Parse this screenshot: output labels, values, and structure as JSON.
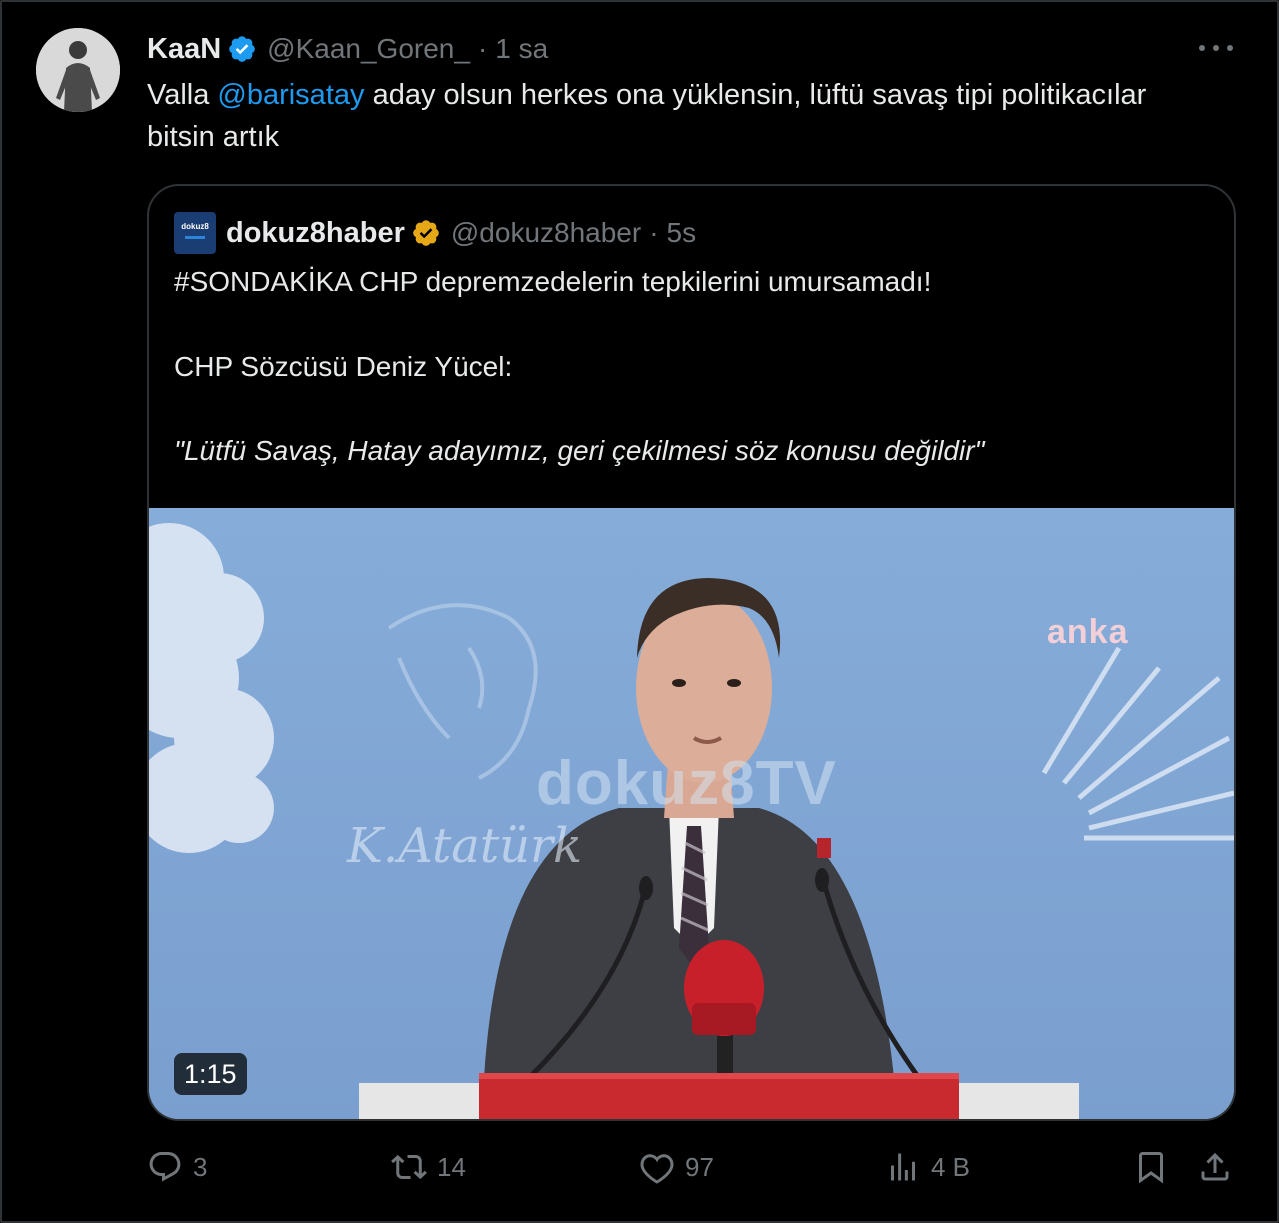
{
  "tweet": {
    "author": {
      "display_name": "KaaN",
      "handle": "@Kaan_Goren_",
      "verified": true,
      "avatar_icon": "person-photo"
    },
    "separator": "·",
    "time": "1 sa",
    "text_before": "Valla ",
    "mention": "@barisatay",
    "text_after": " aday olsun herkes ona yüklensin, lüftü savaş tipi politikacılar bitsin artık"
  },
  "quote": {
    "author": {
      "display_name": "dokuz8haber",
      "handle": "@dokuz8haber",
      "verified": true,
      "verified_color": "#e6a817",
      "avatar_text": "dokuz8",
      "avatar_text_small": "HABER"
    },
    "separator": "·",
    "time": "5s",
    "line1": "#SONDAKİKA CHP depremzedelerin tepkilerini umursamadı!",
    "line2": "CHP Sözcüsü Deniz Yücel:",
    "line3": "\"Lütfü Savaş, Hatay adayımız, geri çekilmesi söz konusu değildir\"",
    "media": {
      "duration": "1:15",
      "watermark_anka": "anka",
      "watermark_dokuz": "dokuz8TV",
      "watermark_signature": "K.Atatürk",
      "mic_logo": "anka"
    }
  },
  "actions": {
    "reply": {
      "icon": "reply-icon",
      "count": "3"
    },
    "retweet": {
      "icon": "retweet-icon",
      "count": "14"
    },
    "like": {
      "icon": "heart-icon",
      "count": "97"
    },
    "views": {
      "icon": "views-icon",
      "count": "4 B"
    },
    "bookmark": {
      "icon": "bookmark-icon"
    },
    "share": {
      "icon": "share-icon"
    }
  },
  "colors": {
    "background": "#000000",
    "text": "#e7e9ea",
    "muted": "#71767b",
    "link": "#1d9bf0",
    "border": "#2f3336",
    "verified_blue": "#1d9bf0",
    "verified_gold": "#e6a817"
  }
}
